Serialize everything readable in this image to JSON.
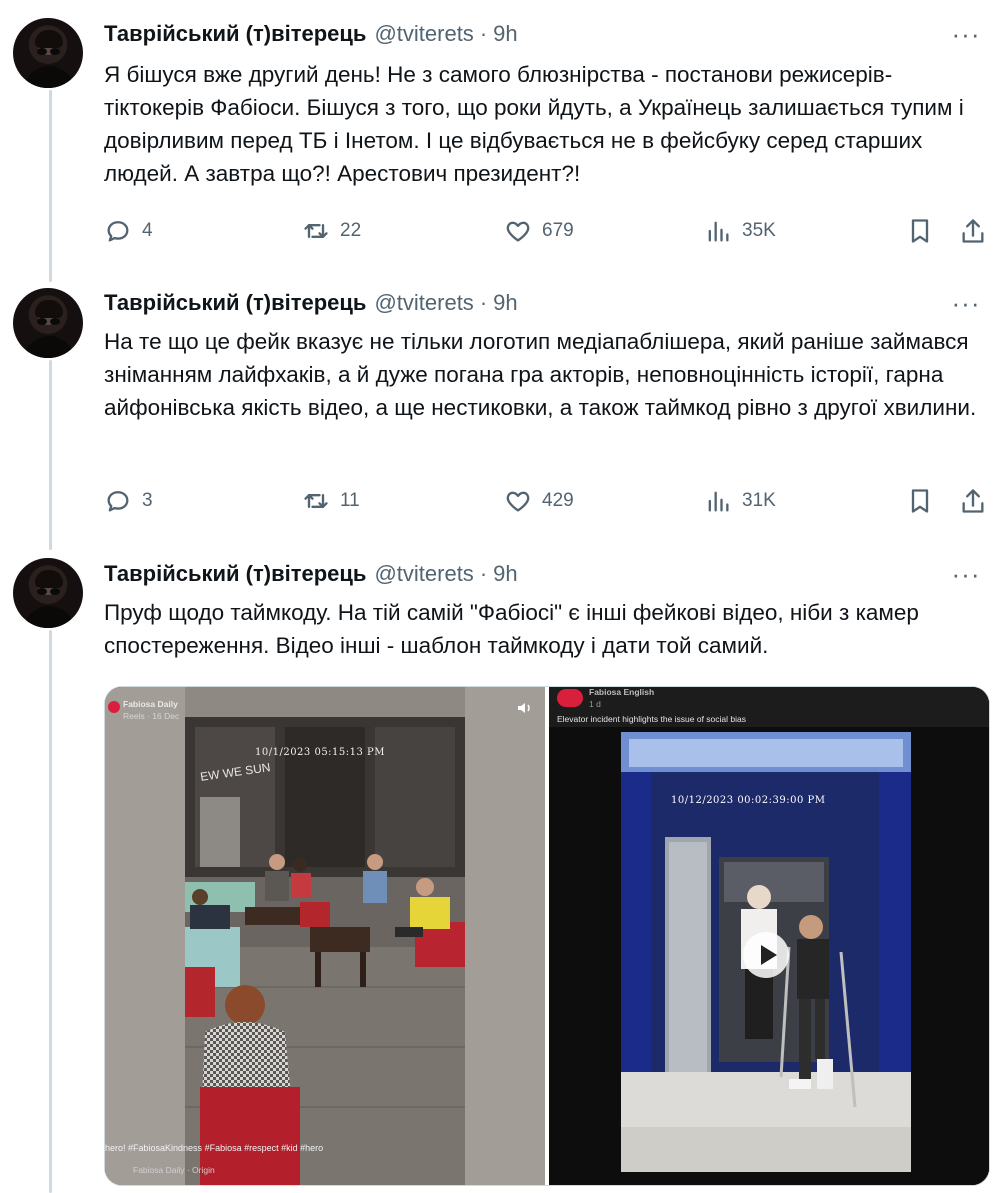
{
  "tweets": [
    {
      "author_name": "Таврійський (т)вітерець",
      "handle": "@tviterets",
      "separator": "·",
      "time": "9h",
      "more": "···",
      "text": "Я бішуся вже другий день! Не з самого блюзнірства - постанови режисерів-тіктокерів Фабіоси. Бішуся з того, що роки йдуть, а Українець залишається тупим і довірливим перед ТБ і Інетом. І це відбувається не в фейсбуку серед старших людей. А завтра що?! Арестович президент?!",
      "replies": "4",
      "retweets": "22",
      "likes": "679",
      "views": "35K"
    },
    {
      "author_name": "Таврійський (т)вітерець",
      "handle": "@tviterets",
      "separator": "·",
      "time": "9h",
      "more": "···",
      "text": "На те що це фейк вказує не тільки логотип медіапаблішера, який раніше займався зніманням лайфхаків, а й дуже погана гра акторів, неповноцінність історії, гарна айфонівська якість відео, а ще нестиковки, а також таймкод рівно з другої хвилини.",
      "replies": "3",
      "retweets": "11",
      "likes": "429",
      "views": "31K"
    },
    {
      "author_name": "Таврійський (т)вітерець",
      "handle": "@tviterets",
      "separator": "·",
      "time": "9h",
      "more": "···",
      "text": "Пруф щодо таймкоду. На тій самій \"Фабіосі\" є інші фейкові відео, ніби з камер спостереження. Відео інші - шаблон таймкоду і дати той самий."
    }
  ],
  "media": {
    "left": {
      "page_name": "Fabiosa Daily",
      "meta": "Reels · 16 Dec",
      "stamp": "10/1/2023   05:15:13 PM",
      "wall_text": "EW WE SUN",
      "hashtags": "hero! #FabiosaKindness #Fabiosa #respect #kid #hero",
      "audio": "Fabiosa Daily · Origin"
    },
    "right": {
      "page_name": "Fabiosa English",
      "meta": "1 d",
      "headline": "Elevator incident highlights the issue of social bias",
      "stamp": "10/12/2023   00:02:39:00 PM"
    }
  },
  "colors": {
    "text": "#0f1419",
    "secondary": "#536471",
    "thread_line": "#cfd9de"
  },
  "icons": [
    "reply-icon",
    "retweet-icon",
    "like-icon",
    "views-icon",
    "bookmark-icon",
    "share-icon",
    "more-icon",
    "play-icon",
    "volume-icon"
  ]
}
